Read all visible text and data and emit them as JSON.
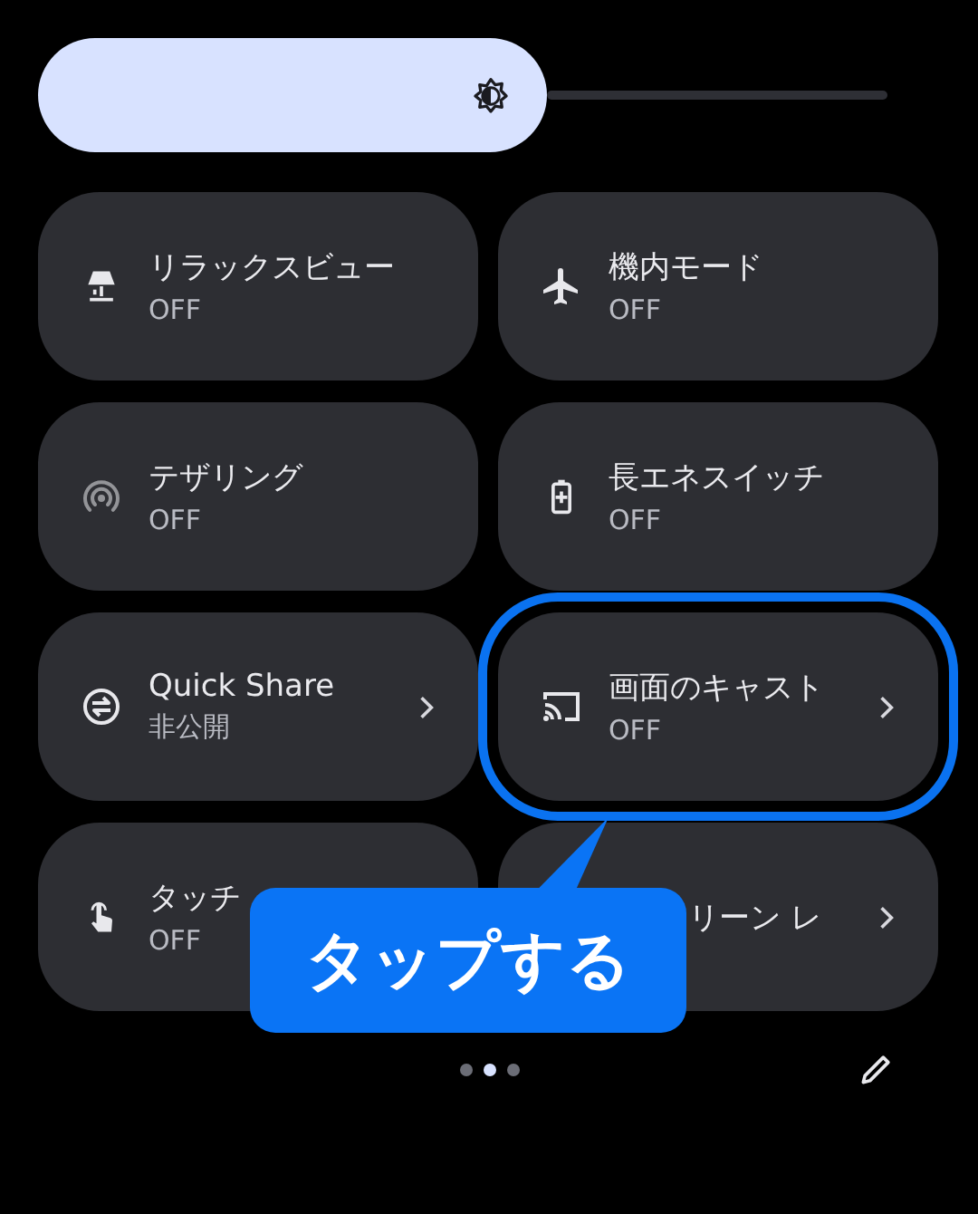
{
  "brightness": {
    "level": 0.6
  },
  "tiles": [
    {
      "kind": "lamp",
      "title": "リラックスビュー",
      "status": "OFF",
      "disabled": false,
      "has_detail": false,
      "highlighted": false
    },
    {
      "kind": "airplane",
      "title": "機内モード",
      "status": "OFF",
      "disabled": false,
      "has_detail": false,
      "highlighted": false
    },
    {
      "kind": "hotspot",
      "title": "テザリング",
      "status": "OFF",
      "disabled": true,
      "has_detail": false,
      "highlighted": false
    },
    {
      "kind": "battery",
      "title": "長エネスイッチ",
      "status": "OFF",
      "disabled": false,
      "has_detail": false,
      "highlighted": false
    },
    {
      "kind": "share",
      "title": "Quick Share",
      "status": "非公開",
      "disabled": false,
      "has_detail": true,
      "highlighted": false
    },
    {
      "kind": "cast",
      "title": "画面のキャスト",
      "status": "OFF",
      "disabled": false,
      "has_detail": true,
      "highlighted": true
    },
    {
      "kind": "touch",
      "title": "タッチ",
      "status": "OFF",
      "disabled": false,
      "highlighted": false
    },
    {
      "kind": "covered",
      "title": "リーン レ",
      "has_detail": true,
      "highlighted": false
    }
  ],
  "callout": {
    "text": "タップする"
  },
  "pages": [
    {
      "selected": false
    },
    {
      "selected": true
    },
    {
      "selected": false
    }
  ]
}
